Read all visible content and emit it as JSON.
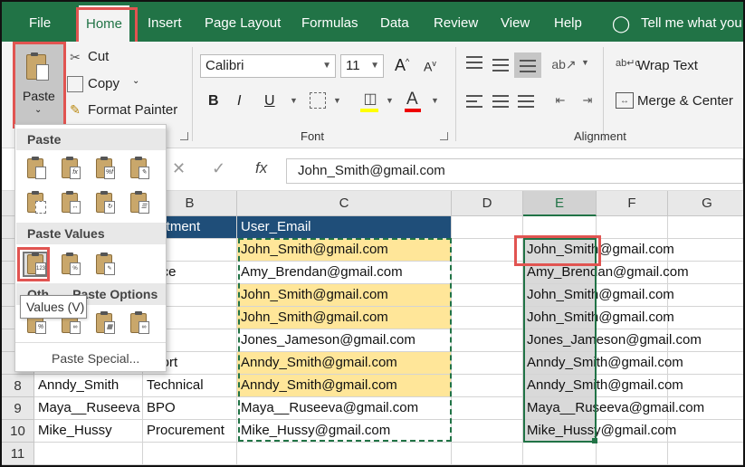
{
  "tabs": [
    "File",
    "Home",
    "Insert",
    "Page Layout",
    "Formulas",
    "Data",
    "Review",
    "View",
    "Help"
  ],
  "tell_me": "Tell me what you",
  "clipboard": {
    "paste": "Paste",
    "cut": "Cut",
    "copy": "Copy",
    "format_painter": "Format Painter"
  },
  "font": {
    "name": "Calibri",
    "size": "11",
    "group": "Font",
    "bold": "B",
    "italic": "I",
    "underline": "U",
    "font_color_glyph": "A"
  },
  "alignment": {
    "wrap_text": "Wrap Text",
    "merge_center": "Merge & Center",
    "group": "Alignment",
    "wrap_glyph": "ab↵c"
  },
  "formula_bar": {
    "fx": "fx",
    "content": "John_Smith@gmail.com"
  },
  "columns": [
    "B",
    "C",
    "D",
    "E",
    "F",
    "G"
  ],
  "rows": [
    "8",
    "9",
    "10",
    "11"
  ],
  "header_row": {
    "department": "partment",
    "email": "User_Email"
  },
  "department_col": [
    "",
    "ance",
    "",
    "",
    "es",
    "pport",
    "Technical",
    "BPO",
    "Procurement"
  ],
  "name_col": {
    "r8": "Anndy_Smith",
    "r9": "Maya__Ruseeva",
    "r10": "Mike_Hussy"
  },
  "emails": [
    "John_Smith@gmail.com",
    "Amy_Brendan@gmail.com",
    "John_Smith@gmail.com",
    "John_Smith@gmail.com",
    "Jones_Jameson@gmail.com",
    "Anndy_Smith@gmail.com",
    "Anndy_Smith@gmail.com",
    "Maya__Ruseeva@gmail.com",
    "Mike_Hussy@gmail.com"
  ],
  "pasted_values": [
    "John_Smith@gmail.com",
    "Amy_Brendan@gmail.com",
    "John_Smith@gmail.com",
    "John_Smith@gmail.com",
    "Jones_Jameson@gmail.com",
    "Anndy_Smith@gmail.com",
    "Anndy_Smith@gmail.com",
    "Maya__Ruseeva@gmail.com",
    "Mike_Hussy@gmail.com"
  ],
  "paste_menu": {
    "paste": "Paste",
    "paste_values": "Paste Values",
    "other_options": "Other Paste Options",
    "other_options_left": "Oth",
    "other_options_right": "Paste Options",
    "paste_special": "Paste Special...",
    "tooltip": "Values (V)",
    "badge": "123"
  },
  "colors": {
    "excel_green": "#217346",
    "header_blue": "#1f4e79",
    "highlight_yellow": "#ffe699",
    "annotation_red": "#e15451"
  }
}
